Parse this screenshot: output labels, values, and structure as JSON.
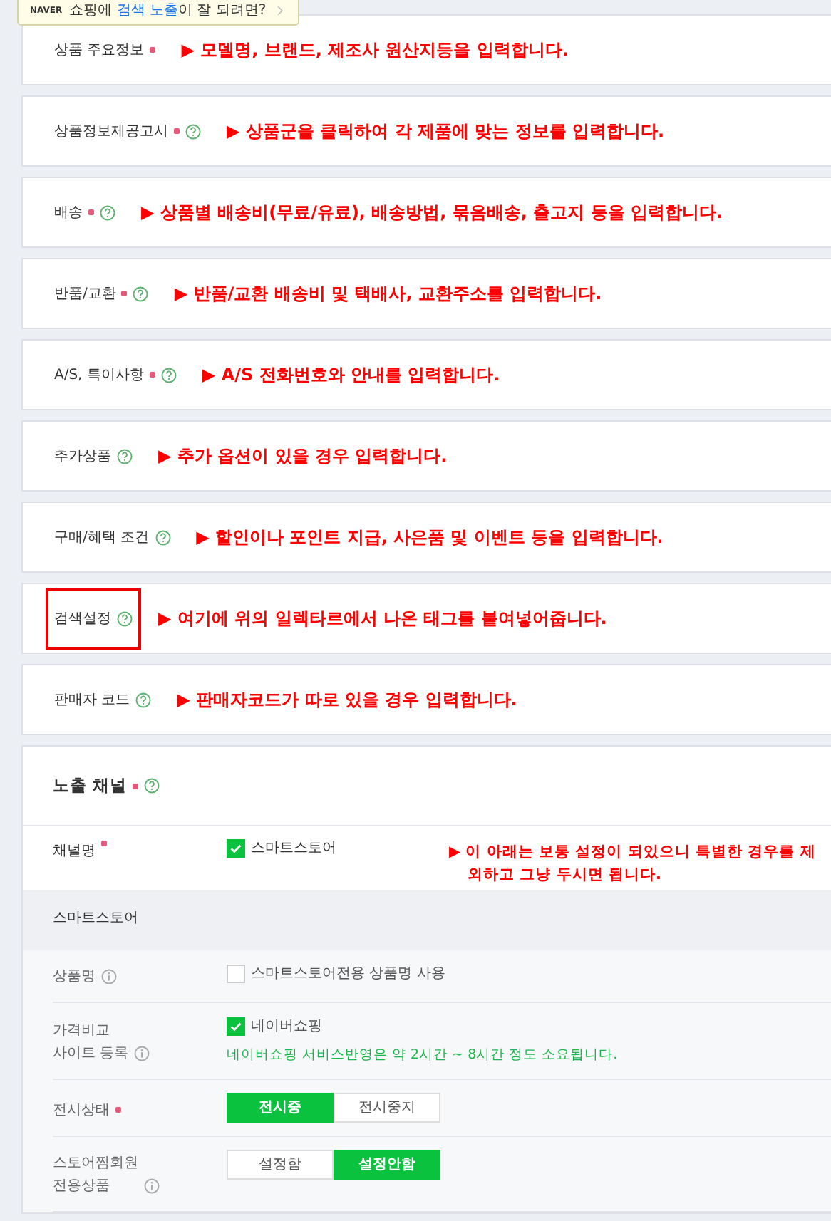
{
  "tooltip": {
    "brand": "NAVER",
    "parts": [
      {
        "text": "쇼핑에 ",
        "highlight": false
      },
      {
        "text": "검색 노출",
        "highlight": true
      },
      {
        "text": "이 잘 되려면?",
        "highlight": false
      }
    ]
  },
  "sections": [
    {
      "label": "상품 주요정보",
      "required": true,
      "help": false,
      "highlighted": false,
      "note": "▶ 모델명, 브랜드, 제조사 원산지등을 입력합니다."
    },
    {
      "label": "상품정보제공고시",
      "required": true,
      "help": true,
      "highlighted": false,
      "note": "▶ 상품군을 클릭하여 각 제품에 맞는 정보를 입력합니다."
    },
    {
      "label": "배송",
      "required": true,
      "help": true,
      "highlighted": false,
      "note": "▶ 상품별 배송비(무료/유료), 배송방법, 묶음배송, 출고지 등을 입력합니다."
    },
    {
      "label": "반품/교환",
      "required": true,
      "help": true,
      "highlighted": false,
      "note": "▶ 반품/교환 배송비 및 택배사, 교환주소를 입력합니다."
    },
    {
      "label": "A/S, 특이사항",
      "required": true,
      "help": true,
      "highlighted": false,
      "note": "▶ A/S 전화번호와 안내를 입력합니다."
    },
    {
      "label": "추가상품",
      "required": false,
      "help": true,
      "highlighted": false,
      "note": "▶ 추가 옵션이 있을 경우 입력합니다."
    },
    {
      "label": "구매/혜택 조건",
      "required": false,
      "help": true,
      "highlighted": false,
      "note": "▶ 할인이나 포인트 지급, 사은품 및 이벤트 등을 입력합니다."
    },
    {
      "label": "검색설정",
      "required": false,
      "help": true,
      "highlighted": true,
      "note": "▶ 여기에 위의 일렉타르에서 나온 태그를 붙여넣어줍니다."
    },
    {
      "label": "판매자 코드",
      "required": false,
      "help": true,
      "highlighted": false,
      "note": "▶ 판매자코드가 따로 있을 경우 입력합니다."
    }
  ],
  "exposure": {
    "title": "노출 채널",
    "required": true,
    "help": true,
    "channel": {
      "label": "채널명",
      "required": true,
      "option": "스마트스토어",
      "checked": true,
      "note": "▶ 이 아래는 보통 설정이 되있으니 특별한 경우를 제외하고 그냥 두시면 됩니다."
    },
    "smartstore": {
      "title": "스마트스토어",
      "rows": [
        {
          "kind": "checkbox",
          "label_lines": [
            "상품명"
          ],
          "required": false,
          "info": true,
          "option": "스마트스토어전용 상품명 사용",
          "checked": false
        },
        {
          "kind": "checkbox",
          "label_lines": [
            "가격비교",
            "사이트 등록"
          ],
          "required": false,
          "info": true,
          "option": "네이버쇼핑",
          "checked": true,
          "hint": "네이버쇼핑 서비스반영은 약 2시간 ~ 8시간 정도 소요됩니다."
        },
        {
          "kind": "toggle",
          "label_lines": [
            "전시상태"
          ],
          "required": true,
          "info": false,
          "options": [
            {
              "label": "전시중",
              "selected": true
            },
            {
              "label": "전시중지",
              "selected": false
            }
          ]
        },
        {
          "kind": "toggle",
          "label_lines": [
            "스토어찜회원",
            "전용상품"
          ],
          "required": false,
          "info": true,
          "options": [
            {
              "label": "설정함",
              "selected": false
            },
            {
              "label": "설정안함",
              "selected": true
            }
          ]
        }
      ]
    }
  }
}
